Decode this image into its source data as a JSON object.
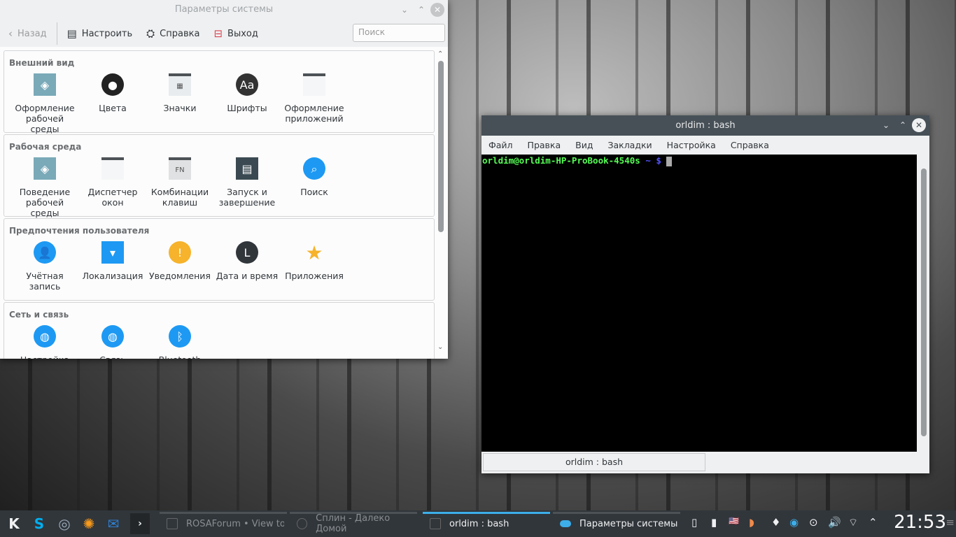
{
  "system_settings": {
    "title": "Параметры системы",
    "toolbar": {
      "back": "Назад",
      "configure": "Настроить",
      "help": "Справка",
      "quit": "Выход",
      "search_placeholder": "Поиск"
    },
    "sections": [
      {
        "title": "Внешний вид",
        "items": [
          {
            "label": "Оформление рабочей среды",
            "icon": "workspace-theme-icon",
            "color": "#7aa9b8",
            "glyph": "◈"
          },
          {
            "label": "Цвета",
            "icon": "colors-icon",
            "color": "#222",
            "glyph": "●"
          },
          {
            "label": "Значки",
            "icon": "icons-icon",
            "color": "#e8ecef",
            "glyph": "▦"
          },
          {
            "label": "Шрифты",
            "icon": "fonts-icon",
            "color": "#333",
            "glyph": "Aa"
          },
          {
            "label": "Оформление приложений",
            "icon": "app-style-icon",
            "color": "#f5f6f7",
            "glyph": ""
          }
        ]
      },
      {
        "title": "Рабочая среда",
        "items": [
          {
            "label": "Поведение рабочей среды",
            "icon": "desktop-behavior-icon",
            "color": "#7aa9b8",
            "glyph": "◈"
          },
          {
            "label": "Диспетчер окон",
            "icon": "window-manager-icon",
            "color": "#f5f6f7",
            "glyph": ""
          },
          {
            "label": "Комбинации клавиш",
            "icon": "shortcuts-icon",
            "color": "#e0e1e2",
            "glyph": "FN"
          },
          {
            "label": "Запуск и завершение",
            "icon": "startup-icon",
            "color": "#3b4a52",
            "glyph": "▤"
          },
          {
            "label": "Поиск",
            "icon": "search-icon",
            "color": "#1d99f3",
            "glyph": "⌕"
          }
        ]
      },
      {
        "title": "Предпочтения пользователя",
        "items": [
          {
            "label": "Учётная запись",
            "icon": "account-icon",
            "color": "#1d99f3",
            "glyph": "👤"
          },
          {
            "label": "Локализация",
            "icon": "localization-icon",
            "color": "#1d99f3",
            "glyph": "▾"
          },
          {
            "label": "Уведомления",
            "icon": "notifications-icon",
            "color": "#f6b32b",
            "glyph": "!"
          },
          {
            "label": "Дата и время",
            "icon": "clock-icon",
            "color": "#31363b",
            "glyph": "L"
          },
          {
            "label": "Приложения",
            "icon": "star-icon",
            "color": "transparent",
            "glyph": "★"
          }
        ]
      },
      {
        "title": "Сеть и связь",
        "items": [
          {
            "label": "Настройка",
            "icon": "globe-icon",
            "color": "#1d99f3",
            "glyph": "◍"
          },
          {
            "label": "Связь",
            "icon": "globe-icon",
            "color": "#1d99f3",
            "glyph": "◍"
          },
          {
            "label": "Bluetooth",
            "icon": "bluetooth-icon",
            "color": "#1d99f3",
            "glyph": "ᛒ"
          }
        ]
      }
    ]
  },
  "terminal": {
    "title": "orldim : bash",
    "menu": [
      "Файл",
      "Правка",
      "Вид",
      "Закладки",
      "Настройка",
      "Справка"
    ],
    "prompt_user": "orldim@orldim-HP-ProBook-4540s",
    "prompt_path": "~ $",
    "tab_label": "orldim : bash"
  },
  "taskbar": {
    "tasks": [
      "ROSAForum • View topic",
      "Сплин - Далеко Домой",
      "orldim : bash",
      "Параметры системы"
    ],
    "clock": "21:53"
  }
}
